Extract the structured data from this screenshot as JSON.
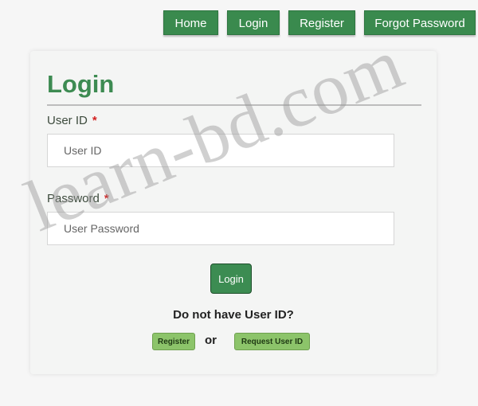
{
  "nav": {
    "home": "Home",
    "login": "Login",
    "register": "Register",
    "forgot_password": "Forgot Password"
  },
  "form": {
    "title": "Login",
    "user_id": {
      "label": "User ID",
      "required_mark": "*",
      "placeholder": "User ID",
      "value": ""
    },
    "password": {
      "label": "Password",
      "required_mark": "*",
      "placeholder": "User Password",
      "value": ""
    },
    "submit_label": "Login",
    "no_account_text": "Do not have User ID?",
    "register_label": "Register",
    "or_text": "or",
    "request_label": "Request User ID"
  },
  "watermark": {
    "text": "learn-bd.com"
  },
  "colors": {
    "primary_green": "#3a8a4e",
    "light_green": "#8cc46a",
    "required_red": "#d32020"
  }
}
